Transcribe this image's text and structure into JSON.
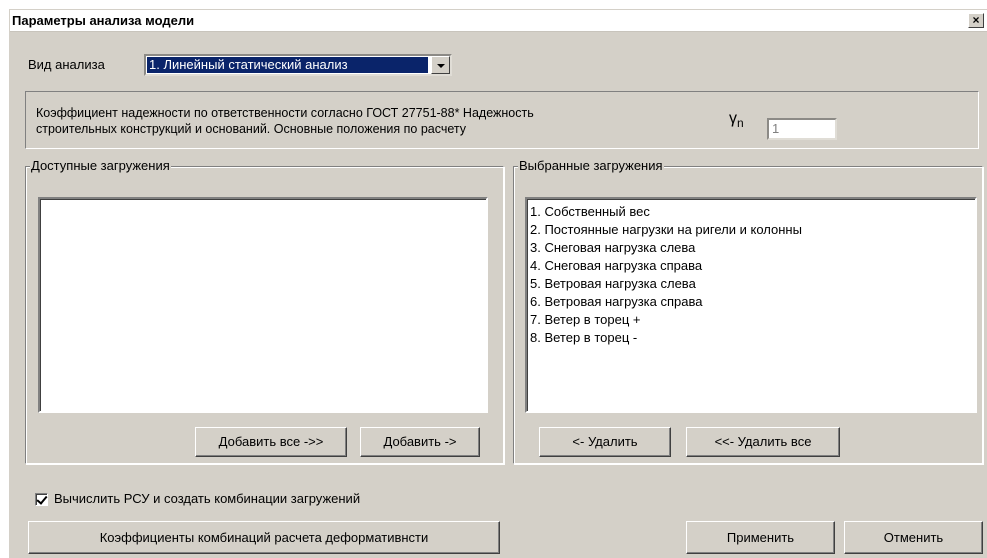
{
  "window": {
    "title": "Параметры анализа  модели",
    "close_label": "×"
  },
  "analysis_type": {
    "label": "Вид анализа",
    "selected": "1. Линейный статический анализ"
  },
  "reliability": {
    "text_line1": "Коэффициент надежности по ответственности согласно ГОСТ 27751-88* Надежность",
    "text_line2": "строительных конструкций и оснований. Основные положения по расчету",
    "symbol": "γ",
    "symbol_sub": "n",
    "value": "1"
  },
  "available_loads": {
    "title": "Доступные загружения",
    "items": []
  },
  "selected_loads": {
    "title": "Выбранные загружения",
    "items": [
      "1. Собственный вес",
      "2. Постоянные нагрузки на ригели и колонны",
      "3. Снеговая нагрузка слева",
      "4. Снеговая нагрузка справа",
      "5. Ветровая нагрузка слева",
      "6. Ветровая нагрузка справа",
      "7. Ветер в торец +",
      "8. Ветер в торец -"
    ]
  },
  "buttons": {
    "add_all": "Добавить все ->>",
    "add": "Добавить ->",
    "remove": "<- Удалить",
    "remove_all": "<<- Удалить все",
    "coef_combinations": "Коэффициенты комбинаций расчета деформативнсти",
    "apply": "Применить",
    "cancel": "Отменить"
  },
  "rsu_checkbox": {
    "label": "Вычислить РСУ и создать комбинации загружений",
    "checked": true
  },
  "colors": {
    "dialog_bg": "#d4d0c8",
    "selection_bg": "#0a246a"
  }
}
